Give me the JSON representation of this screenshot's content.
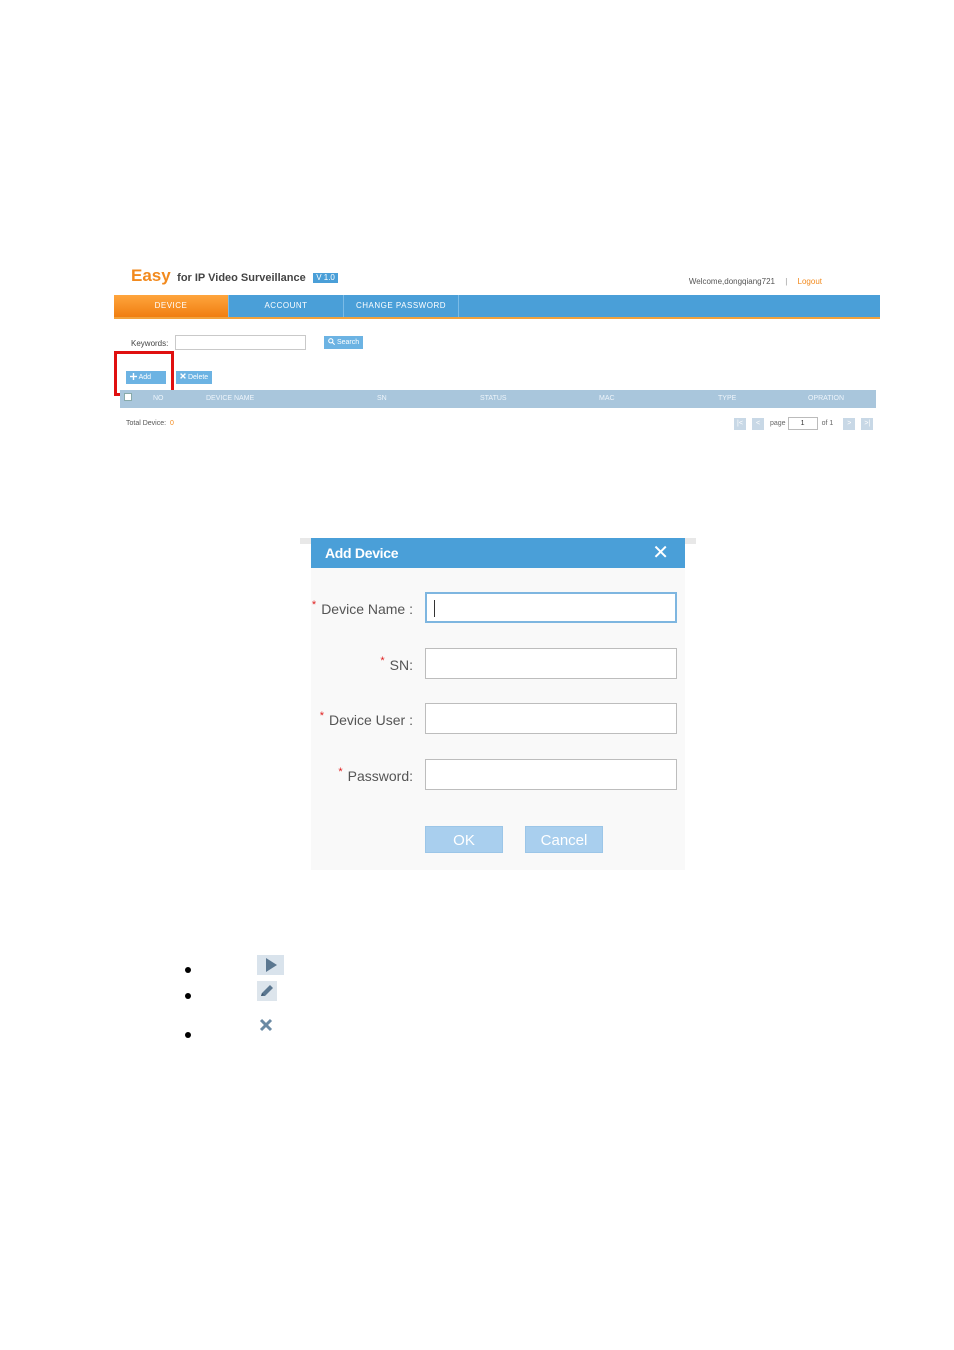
{
  "app": {
    "brand_easy": "Easy",
    "brand_sub": "for IP Video Surveillance",
    "version": "V 1.0",
    "welcome": "Welcome,dongqiang721",
    "separator": "|",
    "logout": "Logout",
    "nav": [
      "DEVICE",
      "ACCOUNT",
      "CHANGE PASSWORD"
    ],
    "active_nav": "DEVICE",
    "keywords_label": "Keywords:",
    "keywords_value": "",
    "search_label": "Search",
    "add_label": "Add",
    "delete_label": "Delete",
    "columns": [
      "NO",
      "DEVICE NAME",
      "SN",
      "STATUS",
      "MAC",
      "TYPE",
      "OPRATION"
    ],
    "total_label": "Total Device:",
    "total_count": "0",
    "page_label": "page",
    "page_value": "1",
    "page_of": "of 1"
  },
  "dialog": {
    "title": "Add Device",
    "required_mark": "*",
    "fields": [
      {
        "label": "Device Name :",
        "value": ""
      },
      {
        "label": "SN:",
        "value": ""
      },
      {
        "label": "Device User :",
        "value": ""
      },
      {
        "label": "Password:",
        "value": ""
      }
    ],
    "ok_label": "OK",
    "cancel_label": "Cancel"
  },
  "legend_icons": [
    "play-icon",
    "edit-pencil-icon",
    "delete-x-icon"
  ],
  "colors": {
    "accent_blue": "#4a9fd8",
    "brand_orange": "#f28a1e",
    "highlight_red": "#e01010",
    "required_red": "#e02020",
    "button_light_blue": "#a9cfee"
  }
}
